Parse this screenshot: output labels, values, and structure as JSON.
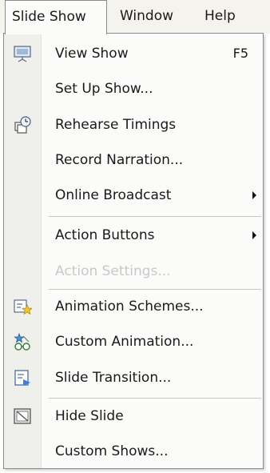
{
  "menubar": {
    "items": [
      {
        "label": "Slide Show"
      },
      {
        "label": "Window"
      },
      {
        "label": "Help"
      }
    ]
  },
  "slide_show_menu": {
    "view_show": {
      "label": "View Show",
      "shortcut": "F5",
      "icon": "projector-screen-icon"
    },
    "set_up_show": {
      "label": "Set Up Show..."
    },
    "rehearse_timings": {
      "label": "Rehearse Timings",
      "icon": "clock-slides-icon"
    },
    "record_narration": {
      "label": "Record Narration..."
    },
    "online_broadcast": {
      "label": "Online Broadcast",
      "submenu": true
    },
    "action_buttons": {
      "label": "Action Buttons",
      "submenu": true
    },
    "action_settings": {
      "label": "Action Settings...",
      "disabled": true
    },
    "animation_schemes": {
      "label": "Animation Schemes...",
      "icon": "animation-star-icon"
    },
    "custom_animation": {
      "label": "Custom Animation...",
      "icon": "custom-animation-icon"
    },
    "slide_transition": {
      "label": "Slide Transition...",
      "icon": "slide-transition-icon"
    },
    "hide_slide": {
      "label": "Hide Slide",
      "icon": "hide-slide-icon"
    },
    "custom_shows": {
      "label": "Custom Shows..."
    }
  }
}
